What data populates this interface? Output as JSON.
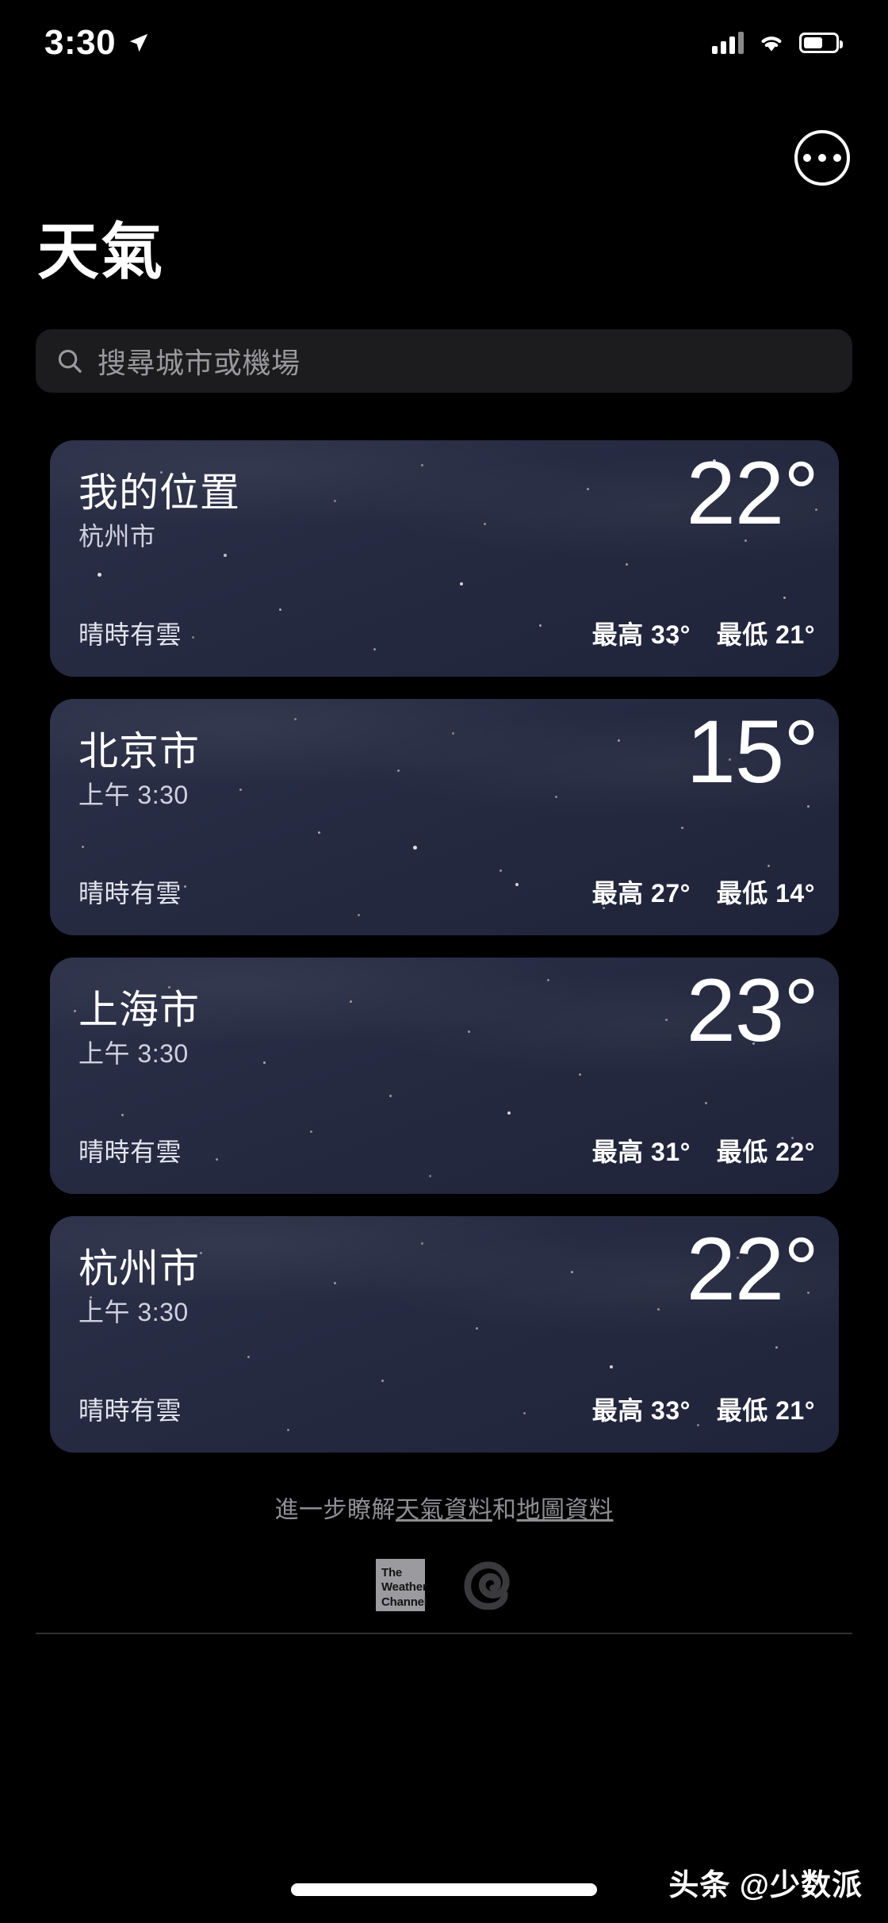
{
  "status_bar": {
    "time": "3:30",
    "location_arrow_icon": "location-arrow-icon",
    "cellular_icon": "cellular-bars-icon",
    "wifi_icon": "wifi-icon",
    "battery_icon": "battery-icon"
  },
  "header": {
    "title": "天氣",
    "more_button_icon": "ellipsis-circle-icon"
  },
  "search": {
    "placeholder": "搜尋城市或機場",
    "icon": "search-icon",
    "value": ""
  },
  "cards": [
    {
      "name": "我的位置",
      "sub": "杭州市",
      "condition": "晴時有雲",
      "temp": "22°",
      "high": "最高 33°",
      "low": "最低 21°"
    },
    {
      "name": "北京市",
      "sub": "上午 3:30",
      "condition": "晴時有雲",
      "temp": "15°",
      "high": "最高 27°",
      "low": "最低 14°"
    },
    {
      "name": "上海市",
      "sub": "上午 3:30",
      "condition": "晴時有雲",
      "temp": "23°",
      "high": "最高 31°",
      "low": "最低 22°"
    },
    {
      "name": "杭州市",
      "sub": "上午 3:30",
      "condition": "晴時有雲",
      "temp": "22°",
      "high": "最高 33°",
      "low": "最低 21°"
    }
  ],
  "footer": {
    "note_prefix": "進一步瞭解",
    "link_weather": "天氣資料",
    "note_middle": "和",
    "link_map": "地圖資料",
    "logo_weather_channel": "The\nWeather\nChannel",
    "logo_weather_channel_line1": "The",
    "logo_weather_channel_line2": "Weather",
    "logo_weather_channel_line3": "Channel",
    "logo_spiral_icon": "spiral-logo-icon"
  },
  "bottom": {
    "home_indicator": "home-indicator",
    "watermark": "头条 @少数派"
  },
  "colors": {
    "background": "#000000",
    "card": "#262b42",
    "search_field": "#1c1c1e",
    "muted_text": "#8e8e93",
    "accent_text": "#ffffff"
  }
}
